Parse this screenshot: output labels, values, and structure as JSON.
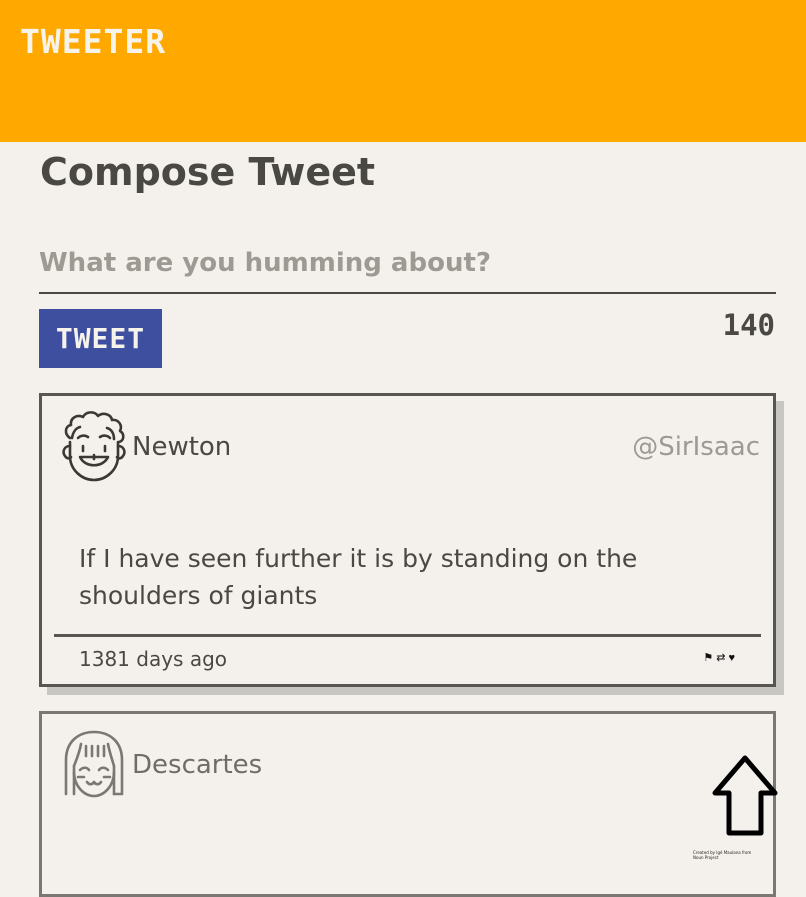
{
  "header": {
    "brand": "TWEETER",
    "color": "#ffa800"
  },
  "compose": {
    "title": "Compose Tweet",
    "placeholder": "What are you humming about?",
    "button_label": "TWEET",
    "char_count": "140",
    "button_color": "#3f4fa0"
  },
  "tweets": [
    {
      "name": "Newton",
      "handle": "@SirIsaac",
      "text": "If I have seen further it is by standing on the shoulders of giants",
      "time": "1381 days ago",
      "avatar_icon": "curly-hair-face-icon",
      "actions": [
        {
          "icon": "flag-icon",
          "glyph": "⚑"
        },
        {
          "icon": "retweet-icon",
          "glyph": "⇄"
        },
        {
          "icon": "heart-icon",
          "glyph": "♥"
        }
      ]
    },
    {
      "name": "Descartes",
      "avatar_icon": "bob-hair-face-icon"
    }
  ],
  "scroll_button": {
    "icon": "arrow-up-icon",
    "credit": "Created by Igé Maulana from Noun Project"
  }
}
